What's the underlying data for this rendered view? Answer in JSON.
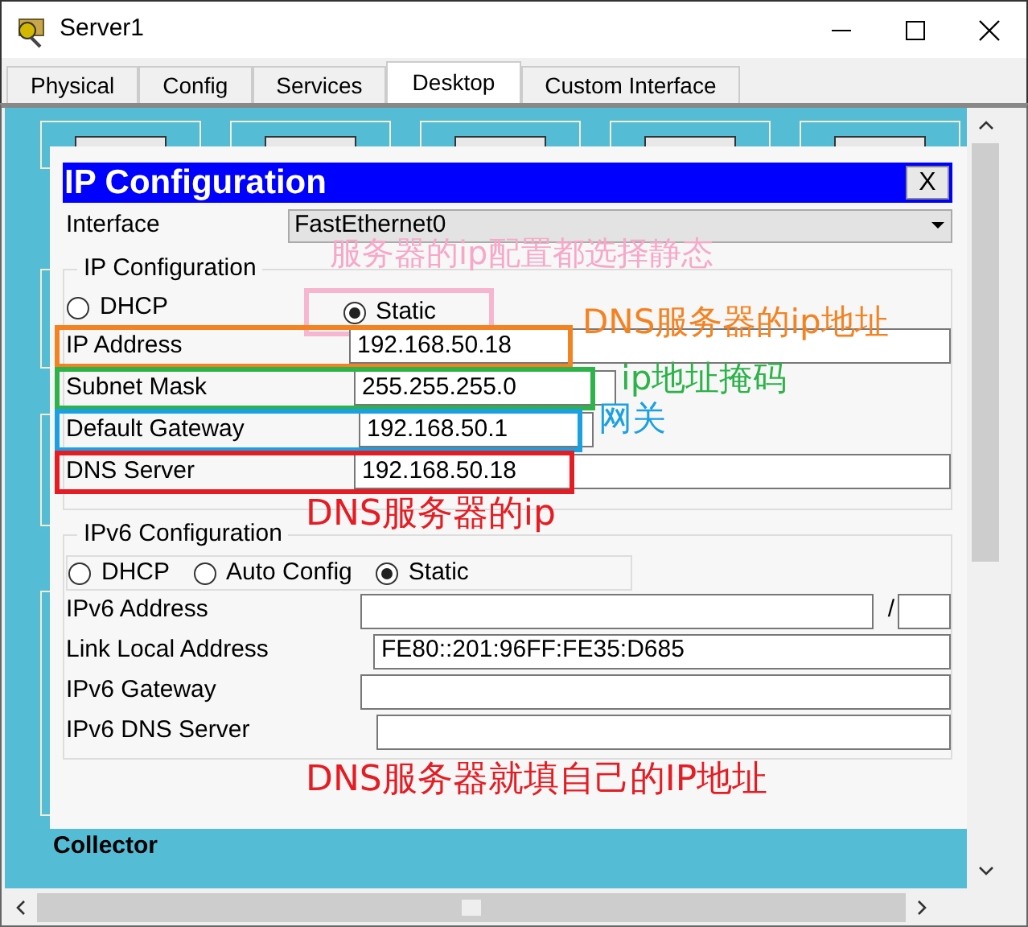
{
  "window": {
    "title": "Server1"
  },
  "tabs": [
    {
      "label": "Physical",
      "selected": false
    },
    {
      "label": "Config",
      "selected": false
    },
    {
      "label": "Services",
      "selected": false
    },
    {
      "label": "Desktop",
      "selected": true
    },
    {
      "label": "Custom Interface",
      "selected": false
    }
  ],
  "desktop": {
    "caption": "Collector"
  },
  "dialog": {
    "title": "IP Configuration",
    "close": "X",
    "interface_label": "Interface",
    "interface_value": "FastEthernet0",
    "ipv4": {
      "legend": "IP Configuration",
      "modes": [
        {
          "label": "DHCP",
          "selected": false
        },
        {
          "label": "Static",
          "selected": true,
          "color": "#f7b6cf"
        }
      ],
      "fields": [
        {
          "label": "IP Address",
          "value": "192.168.50.18",
          "color": "#f58220"
        },
        {
          "label": "Subnet Mask",
          "value": "255.255.255.0",
          "color": "#2db34a"
        },
        {
          "label": "Default Gateway",
          "value": "192.168.50.1",
          "color": "#1ba1e2"
        },
        {
          "label": "DNS Server",
          "value": "192.168.50.18",
          "color": "#e51c23"
        }
      ]
    },
    "ipv6": {
      "legend": "IPv6 Configuration",
      "modes": [
        {
          "label": "DHCP",
          "selected": false
        },
        {
          "label": "Auto Config",
          "selected": false
        },
        {
          "label": "Static",
          "selected": true
        }
      ],
      "fields": [
        {
          "label": "IPv6 Address",
          "separator": "/"
        },
        {
          "label": "Link Local Address",
          "value": "FE80::201:96FF:FE35:D685"
        },
        {
          "label": "IPv6 Gateway"
        },
        {
          "label": "IPv6 DNS Server"
        }
      ]
    }
  },
  "notes": [
    {
      "text": "服务器的ip配置都选择静态",
      "color": "#f7a8c8"
    },
    {
      "text": "DNS服务器的ip地址",
      "color": "#f58220"
    },
    {
      "text": "ip地址掩码",
      "color": "#2db34a"
    },
    {
      "text": "网关",
      "color": "#1ba1e2"
    },
    {
      "text": "DNS服务器的ip",
      "color": "#e51c23"
    },
    {
      "text": "DNS服务器就填自己的IP地址",
      "color": "#e51c23"
    }
  ]
}
